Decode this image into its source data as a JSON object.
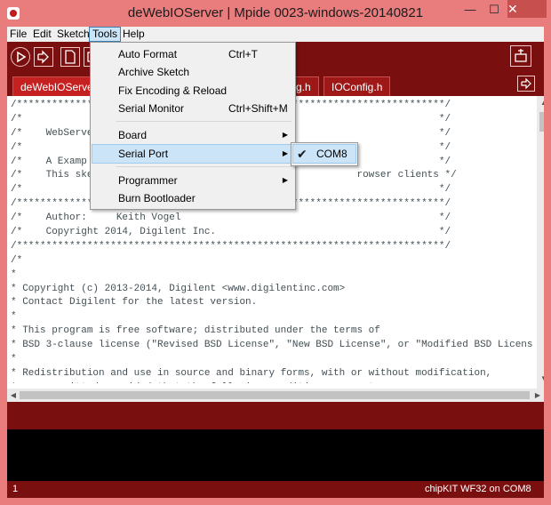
{
  "window": {
    "title": "deWebIOServer | Mpide 0023-windows-20140821",
    "minimize": "—",
    "maximize": "☐",
    "close": "✕"
  },
  "menubar": [
    {
      "label": "File"
    },
    {
      "label": "Edit"
    },
    {
      "label": "Sketch"
    },
    {
      "label": "Tools"
    },
    {
      "label": "Help"
    }
  ],
  "tabs": [
    {
      "label": "deWebIOServer"
    },
    {
      "label": "...fig.h"
    },
    {
      "label": "IOConfig.h"
    }
  ],
  "tools_menu": {
    "items": [
      {
        "label": "Auto Format",
        "shortcut": "Ctrl+T"
      },
      {
        "label": "Archive Sketch",
        "shortcut": ""
      },
      {
        "label": "Fix Encoding & Reload",
        "shortcut": ""
      },
      {
        "label": "Serial Monitor",
        "shortcut": "Ctrl+Shift+M"
      },
      {
        "label": "Board",
        "submenu": true
      },
      {
        "label": "Serial Port",
        "submenu": true,
        "highlighted": true
      },
      {
        "label": "Programmer",
        "submenu": true
      },
      {
        "label": "Burn Bootloader",
        "shortcut": ""
      }
    ]
  },
  "serial_submenu": {
    "items": [
      {
        "label": "COM8",
        "checked": true
      }
    ]
  },
  "code": {
    "lines": [
      "/*************************************************************************/",
      "/*                                                                       */",
      "/*    WebServe                                                           */",
      "/*                                                                       */",
      "/*    A Examp                                                            */",
      "/*    This ske                                             rowser clients */",
      "/*                                                                       */",
      "/*************************************************************************/",
      "/*    Author:     Keith Vogel                                            */",
      "/*    Copyright 2014, Digilent Inc.                                      */",
      "/*************************************************************************/",
      "/*",
      "*",
      "* Copyright (c) 2013-2014, Digilent <www.digilentinc.com>",
      "* Contact Digilent for the latest version.",
      "*",
      "* This program is free software; distributed under the terms of",
      "* BSD 3-clause license (\"Revised BSD License\", \"New BSD License\", or \"Modified BSD Licens",
      "*",
      "* Redistribution and use in source and binary forms, with or without modification,",
      "* are permitted provided that the following conditions are met:"
    ]
  },
  "status": {
    "line_number": "1",
    "board": "chipKIT WF32 on COM8"
  }
}
